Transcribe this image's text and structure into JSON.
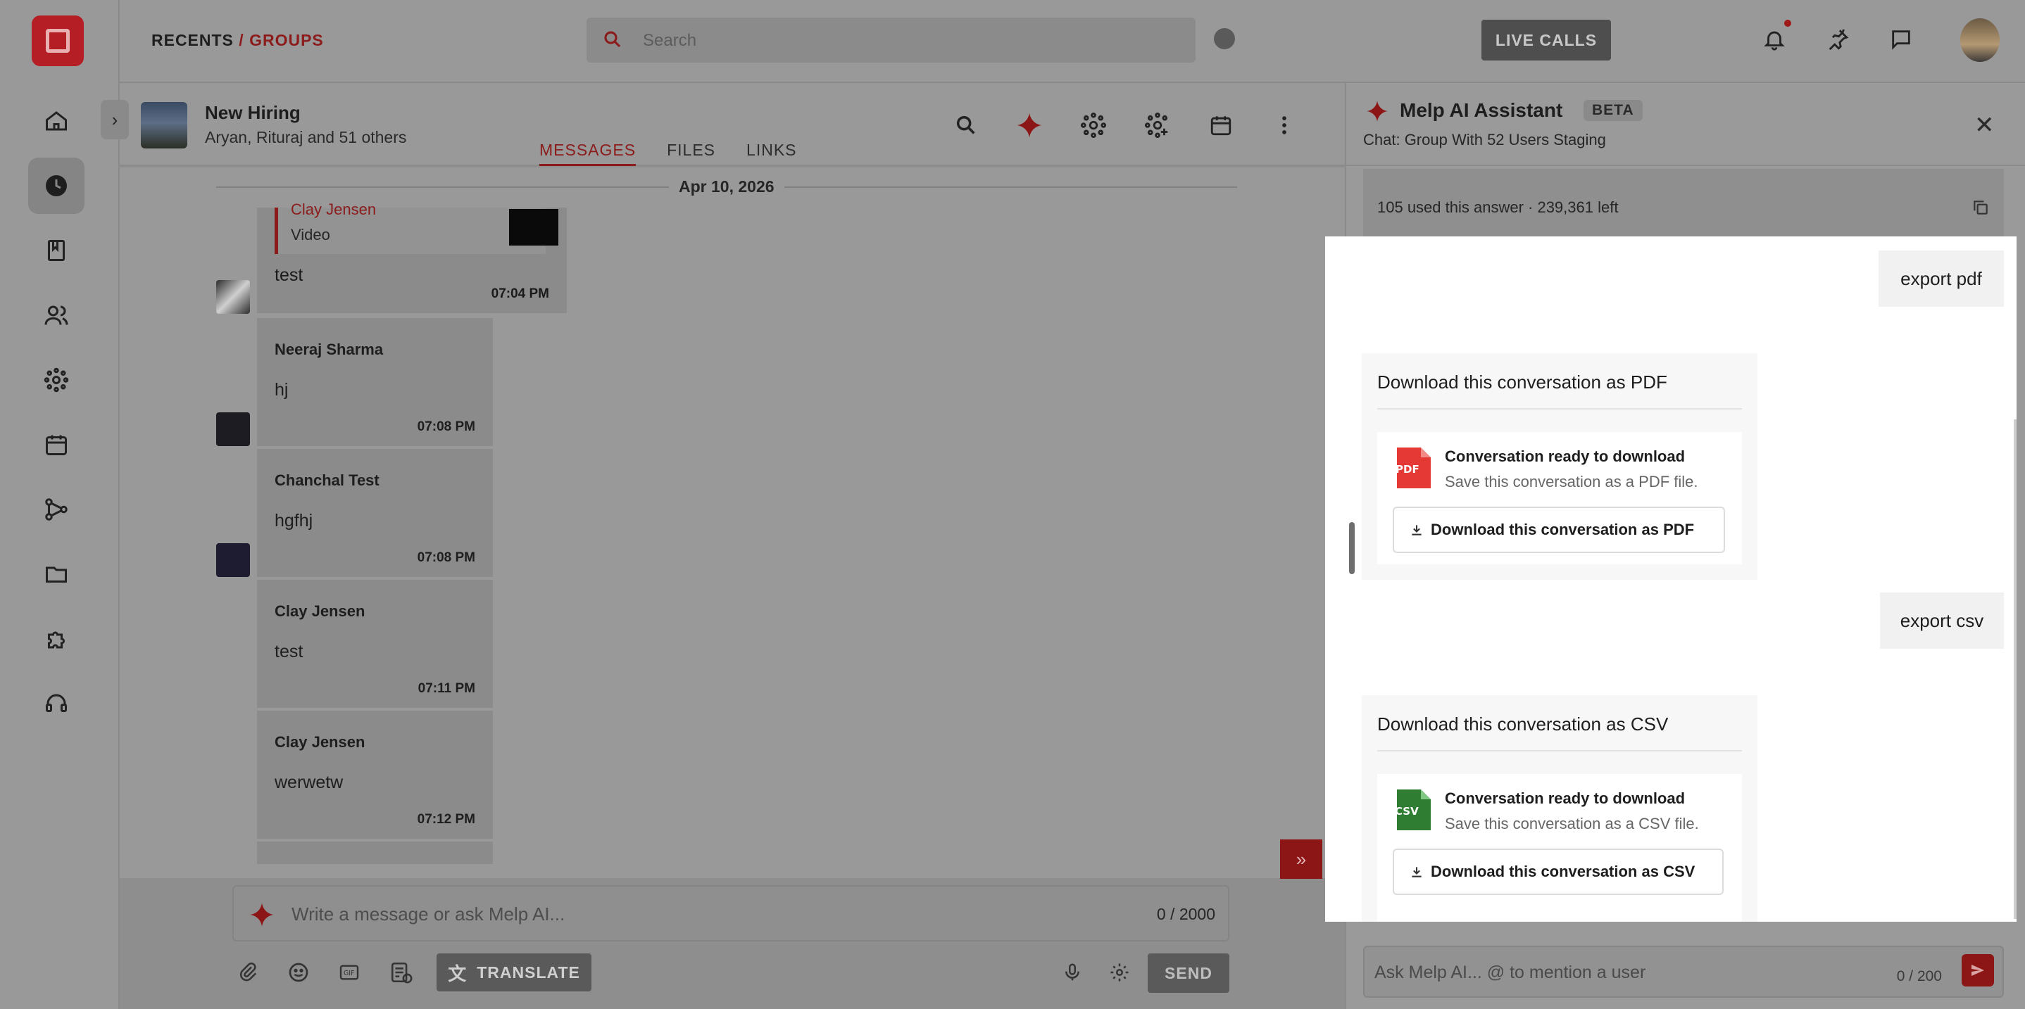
{
  "header": {
    "crumb_recents": "RECENTS",
    "crumb_sep": "/",
    "crumb_groups": "GROUPS",
    "search_placeholder": "Search",
    "live_calls": "LIVE CALLS"
  },
  "chat": {
    "group_name": "New Hiring",
    "members": "Aryan, Rituraj and 51 others",
    "tabs": [
      "MESSAGES",
      "FILES",
      "LINKS"
    ],
    "date": "Apr 10, 2026",
    "reply": {
      "quoted_name": "Clay Jensen",
      "quoted_type": "Video",
      "text": "test",
      "time": "07:04 PM"
    },
    "messages": [
      {
        "name": "Neeraj Sharma",
        "text": "hj",
        "time": "07:08 PM"
      },
      {
        "name": "Chanchal Test",
        "text": "hgfhj",
        "time": "07:08 PM"
      },
      {
        "name": "Clay Jensen",
        "text": "test",
        "time": "07:11 PM"
      },
      {
        "name": "Clay Jensen",
        "text": "werwetw",
        "time": "07:12 PM"
      }
    ],
    "composer_placeholder": "Write a message or ask Melp AI...",
    "composer_count": "0 / 2000",
    "translate_label": "TRANSLATE",
    "send_label": "SEND"
  },
  "ai": {
    "title": "Melp AI Assistant",
    "badge": "BETA",
    "subtitle": "Chat: Group With 52 Users Staging",
    "usage": "105 used this answer · 239,361 left",
    "user_msg_1": "export pdf",
    "pdf_card": {
      "title": "Download this conversation as PDF",
      "ready": "Conversation ready to download",
      "sub": "Save this conversation as a PDF file.",
      "button": "Download this conversation as PDF",
      "icon_text": "PDF"
    },
    "user_msg_2": "export csv",
    "csv_card": {
      "title": "Download this conversation as CSV",
      "ready": "Conversation ready to download",
      "sub": "Save this conversation as a CSV file.",
      "button": "Download this conversation as CSV",
      "icon_text": "CSV"
    },
    "input_placeholder": "Ask Melp AI... @ to mention a user",
    "input_count": "0 / 200"
  },
  "colors": {
    "accent": "#c0262d",
    "pdf": "#e53935",
    "csv": "#2e7d32"
  }
}
